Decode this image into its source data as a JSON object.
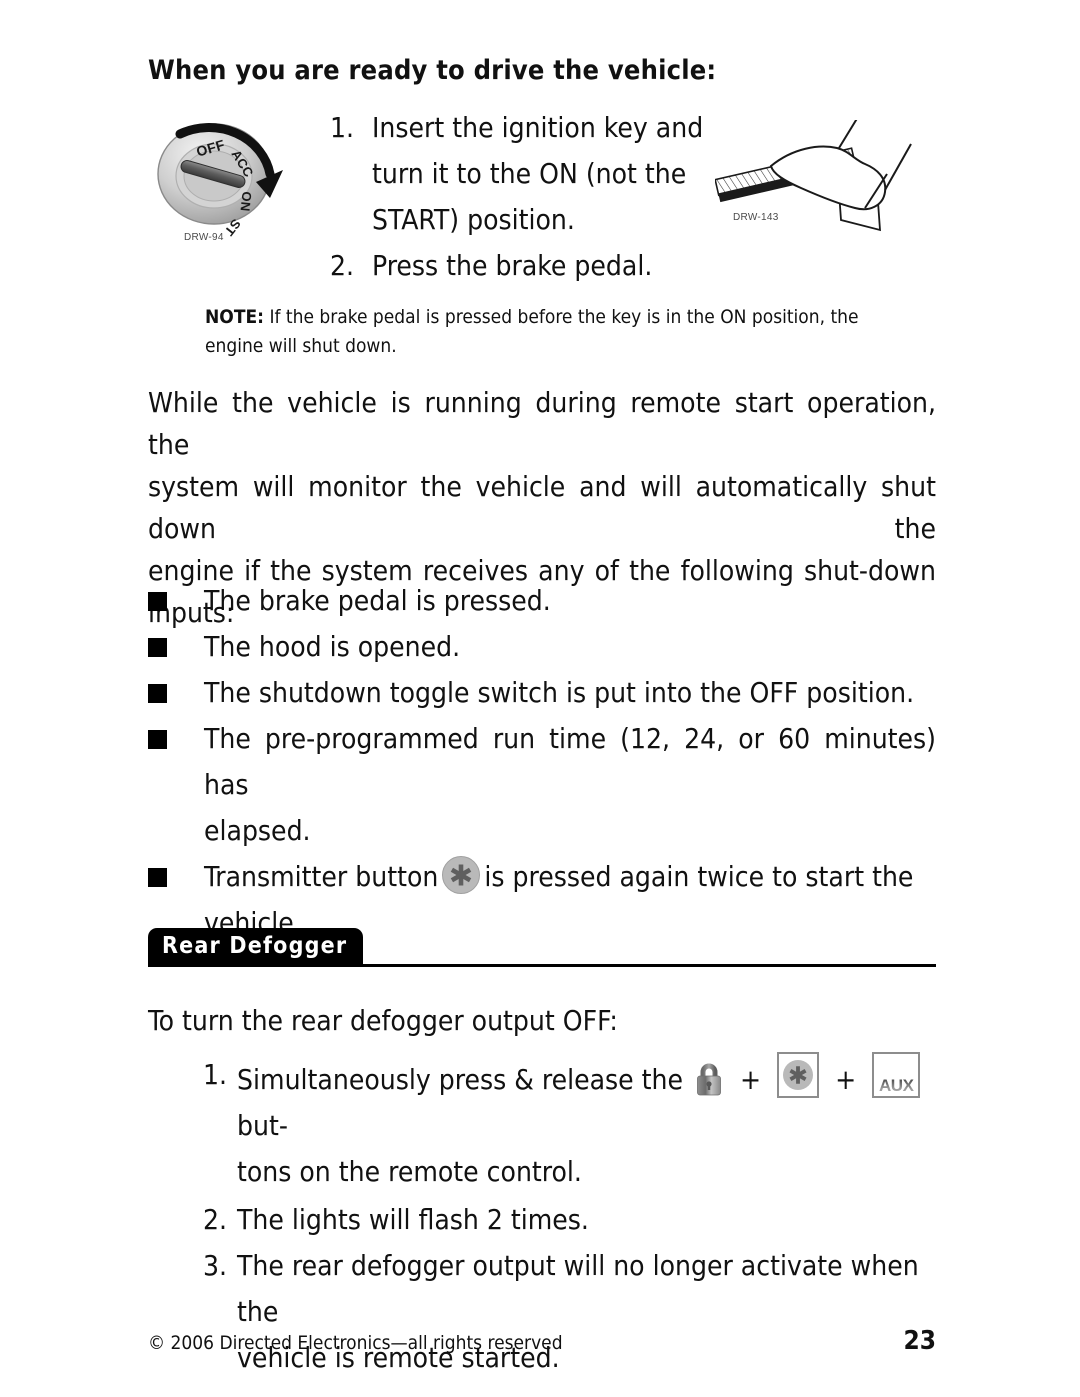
{
  "document": {
    "heading": "When you are ready to drive the vehicle:",
    "top_steps": [
      {
        "num": "1.",
        "lines": [
          "Insert the ignition key and",
          "turn it to the ON (not the",
          "START) position."
        ]
      },
      {
        "num": "2.",
        "lines": [
          "Press the brake pedal."
        ]
      }
    ],
    "note": {
      "label": "NOTE:",
      "text": " If the brake pedal is pressed before the key is in the ON position, the engine will shut down."
    },
    "paragraph": {
      "lines": [
        "While the vehicle is running during remote start operation, the",
        "system will monitor the vehicle and will automatically shut down the",
        "engine if the system receives any of the following shut-down",
        "inputs:"
      ]
    },
    "bullets": [
      {
        "text": "The brake pedal is pressed."
      },
      {
        "text": "The hood is opened."
      },
      {
        "text": "The shutdown toggle switch is put into the OFF position."
      },
      {
        "line1": "The  pre-programmed  run  time  (12,  24,  or  60  minutes)  has",
        "line2": "elapsed."
      },
      {
        "pre": "Transmitter  button",
        "post": "is  pressed  again  twice  to  start  the",
        "line2": "vehicle."
      }
    ],
    "section": {
      "tab_label": "Rear Defogger"
    },
    "defogger": {
      "intro": "To turn the rear defogger output OFF:",
      "step1": {
        "num": "1.",
        "pre": "Simultaneously press & release the",
        "plus1": "+",
        "plus2": "+",
        "post": "but-",
        "line2": "tons on the remote control."
      },
      "step2": {
        "num": "2.",
        "text": "The lights will flash 2 times."
      },
      "step3": {
        "num": "3.",
        "line1": "The rear defogger output will no longer activate when the",
        "line2": "vehicle is remote started."
      }
    },
    "illustrations": {
      "ignition": {
        "caption": "DRW-94",
        "labels": {
          "off": "OFF",
          "acc": "ACC",
          "on": "ON",
          "st": "ST"
        }
      },
      "pedal": {
        "caption": "DRW-143"
      }
    },
    "footer": {
      "copyright": "© 2006 Directed Electronics—all rights reserved",
      "page_number": "23"
    },
    "colors": {
      "text": "#111111",
      "tab_background": "#000000",
      "tab_text": "#ffffff",
      "icon_gray": "#b9b9b9",
      "icon_border": "#8d8d8d"
    }
  }
}
